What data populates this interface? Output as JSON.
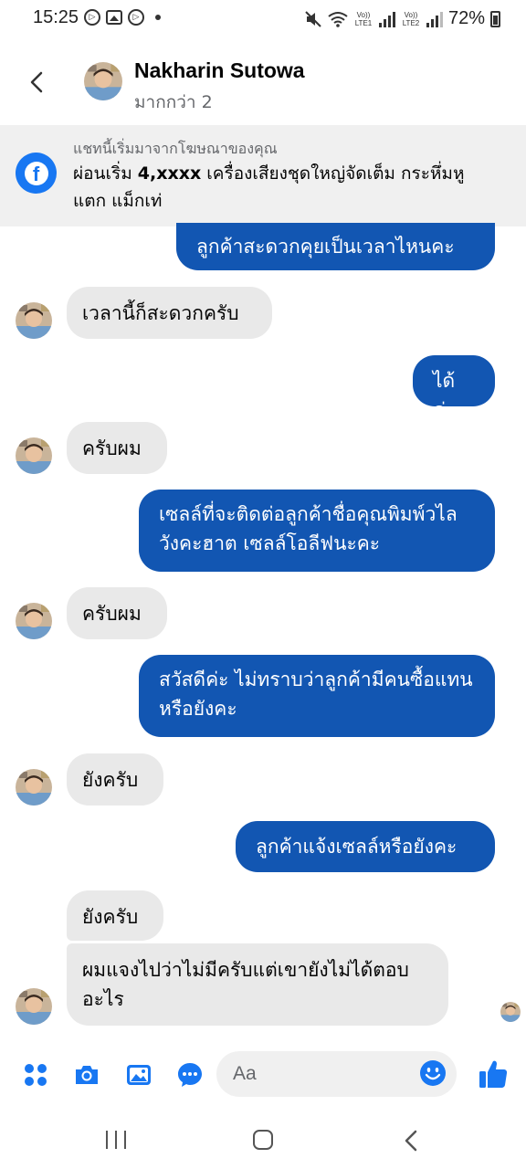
{
  "status_bar": {
    "time": "15:25",
    "battery": "72%",
    "sim1_label": "Vo)) LTE1",
    "sim2_label": "Vo)) LTE2"
  },
  "header": {
    "contact_name": "Nakharin Sutowa",
    "subtitle": "มากกว่า 2"
  },
  "ad_banner": {
    "caption": "แชทนี้เริ่มมาจากโฆษณาของคุณ",
    "text_prefix": "ผ่อนเริ่ม ",
    "text_bold": "4,xxxx",
    "text_suffix": " เครื่องเสียงชุดใหญ่จัดเต็ม กระหึ่มหู แตก แม็กเท่"
  },
  "messages": [
    {
      "from": "me",
      "text": "ลูกค้าสะดวกคุยเป็นเวลาไหนคะ"
    },
    {
      "from": "contact",
      "text": "เวลานี้ก็สะดวกครับ"
    },
    {
      "from": "me",
      "text": "ได้ค่ะ"
    },
    {
      "from": "contact",
      "text": "ครับผม"
    },
    {
      "from": "me",
      "text": "เซลล์ที่จะติดต่อลูกค้าชื่อคุณพิมพ์วไล วังคะฮาต เซลล์โอลีฟนะคะ"
    },
    {
      "from": "contact",
      "text": "ครับผม"
    },
    {
      "from": "me",
      "text": "สวัสดีค่ะ ไม่ทราบว่าลูกค้ามีคนซื้อแทนหรือยังคะ"
    },
    {
      "from": "contact",
      "text": "ยังครับ"
    },
    {
      "from": "me",
      "text": "ลูกค้าแจ้งเซลล์หรือยังคะ"
    },
    {
      "from": "contact",
      "text": "ยังครับ"
    },
    {
      "from": "contact",
      "text": "ผมแจงไปว่าไม่มีครับแต่เขายังไม่ได้ตอบอะไร"
    }
  ],
  "composer": {
    "placeholder": "Aa"
  },
  "colors": {
    "outgoing_bubble": "#1256b2",
    "incoming_bubble": "#e9e9e9",
    "accent": "#1877f2",
    "banner_bg": "#f0f0f0"
  },
  "icons": [
    "back-arrow-icon",
    "facebook-icon",
    "apps-icon",
    "camera-icon",
    "gallery-icon",
    "chat-bubble-icon",
    "emoji-icon",
    "thumbs-up-icon"
  ]
}
